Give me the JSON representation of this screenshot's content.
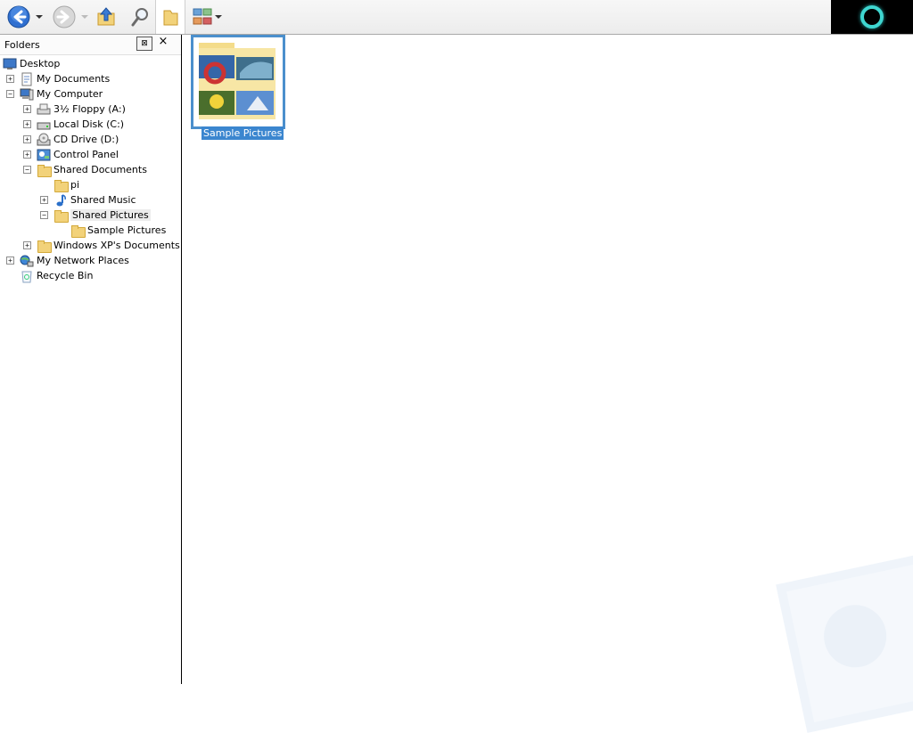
{
  "toolbar": {
    "back_icon": "back-arrow-icon",
    "forward_icon": "forward-arrow-icon",
    "up_icon": "up-folder-icon",
    "search_icon": "search-icon",
    "folders_icon": "folders-icon",
    "views_icon": "views-icon"
  },
  "folders_pane": {
    "title": "Folders",
    "pin_symbol": "⊠",
    "close_symbol": "×",
    "tree": [
      {
        "label": "Desktop",
        "icon": "desktop-icon",
        "expander": ""
      },
      {
        "label": "My Documents",
        "icon": "documents-icon",
        "expander": "+"
      },
      {
        "label": "My Computer",
        "icon": "computer-icon",
        "expander": "−"
      },
      {
        "label": "3½ Floppy (A:)",
        "icon": "floppy-drive-icon",
        "expander": "+"
      },
      {
        "label": "Local Disk (C:)",
        "icon": "hard-disk-icon",
        "expander": "+"
      },
      {
        "label": "CD Drive (D:)",
        "icon": "cd-drive-icon",
        "expander": "+"
      },
      {
        "label": "Control Panel",
        "icon": "control-panel-icon",
        "expander": "+"
      },
      {
        "label": "Shared Documents",
        "icon": "folder-icon",
        "expander": "−"
      },
      {
        "label": "pi",
        "icon": "folder-icon",
        "expander": ""
      },
      {
        "label": "Shared Music",
        "icon": "music-folder-icon",
        "expander": "+"
      },
      {
        "label": "Shared Pictures",
        "icon": "folder-icon",
        "expander": "−"
      },
      {
        "label": "Sample Pictures",
        "icon": "folder-icon",
        "expander": ""
      },
      {
        "label": "Windows XP's Documents",
        "icon": "folder-icon",
        "expander": "+"
      },
      {
        "label": "My Network Places",
        "icon": "network-icon",
        "expander": "+"
      },
      {
        "label": "Recycle Bin",
        "icon": "recycle-bin-icon",
        "expander": ""
      }
    ]
  },
  "content": {
    "items": [
      {
        "label": "Sample Pictures",
        "icon": "picture-folder-thumbnail"
      }
    ]
  },
  "colors": {
    "selection": "#3b86cf",
    "accent": "#4b8fcc",
    "logo_ring": "#3fd6d0"
  }
}
